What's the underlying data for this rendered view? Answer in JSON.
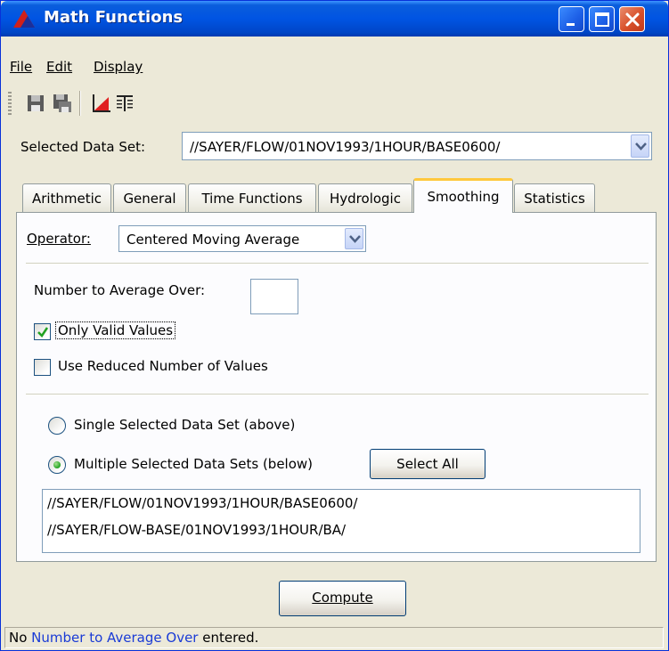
{
  "window": {
    "title": "Math Functions",
    "accent": "#0054e3",
    "close_color": "#d8502b"
  },
  "menu": {
    "file": "File",
    "edit": "Edit",
    "display": "Display"
  },
  "toolbar": {
    "icons": [
      "save-icon",
      "save-as-icon",
      "plot-icon",
      "table-icon"
    ]
  },
  "selected_data_set": {
    "label": "Selected Data Set:",
    "value": "//SAYER/FLOW/01NOV1993/1HOUR/BASE0600/"
  },
  "tabs": [
    {
      "label": "Arithmetic"
    },
    {
      "label": "General"
    },
    {
      "label": "Time Functions"
    },
    {
      "label": "Hydrologic"
    },
    {
      "label": "Smoothing",
      "active": true
    },
    {
      "label": "Statistics"
    }
  ],
  "smoothing": {
    "operator_label": "Operator:",
    "operator_value": "Centered Moving Average",
    "number_label": "Number to Average Over:",
    "number_value": "",
    "only_valid_label": "Only Valid Values",
    "only_valid_checked": true,
    "reduced_label": "Use Reduced Number of Values",
    "reduced_checked": false,
    "single_label": "Single Selected Data Set (above)",
    "multiple_label": "Multiple Selected Data Sets (below)",
    "selected_mode": "multiple",
    "select_all_label": "Select All",
    "data_sets": [
      "//SAYER/FLOW/01NOV1993/1HOUR/BASE0600/",
      "//SAYER/FLOW-BASE/01NOV1993/1HOUR/BA/"
    ]
  },
  "compute_label": "Compute",
  "status": {
    "prefix": "No ",
    "highlight": "Number to Average Over",
    "suffix": " entered.",
    "highlight_color": "#1a3bd6"
  }
}
